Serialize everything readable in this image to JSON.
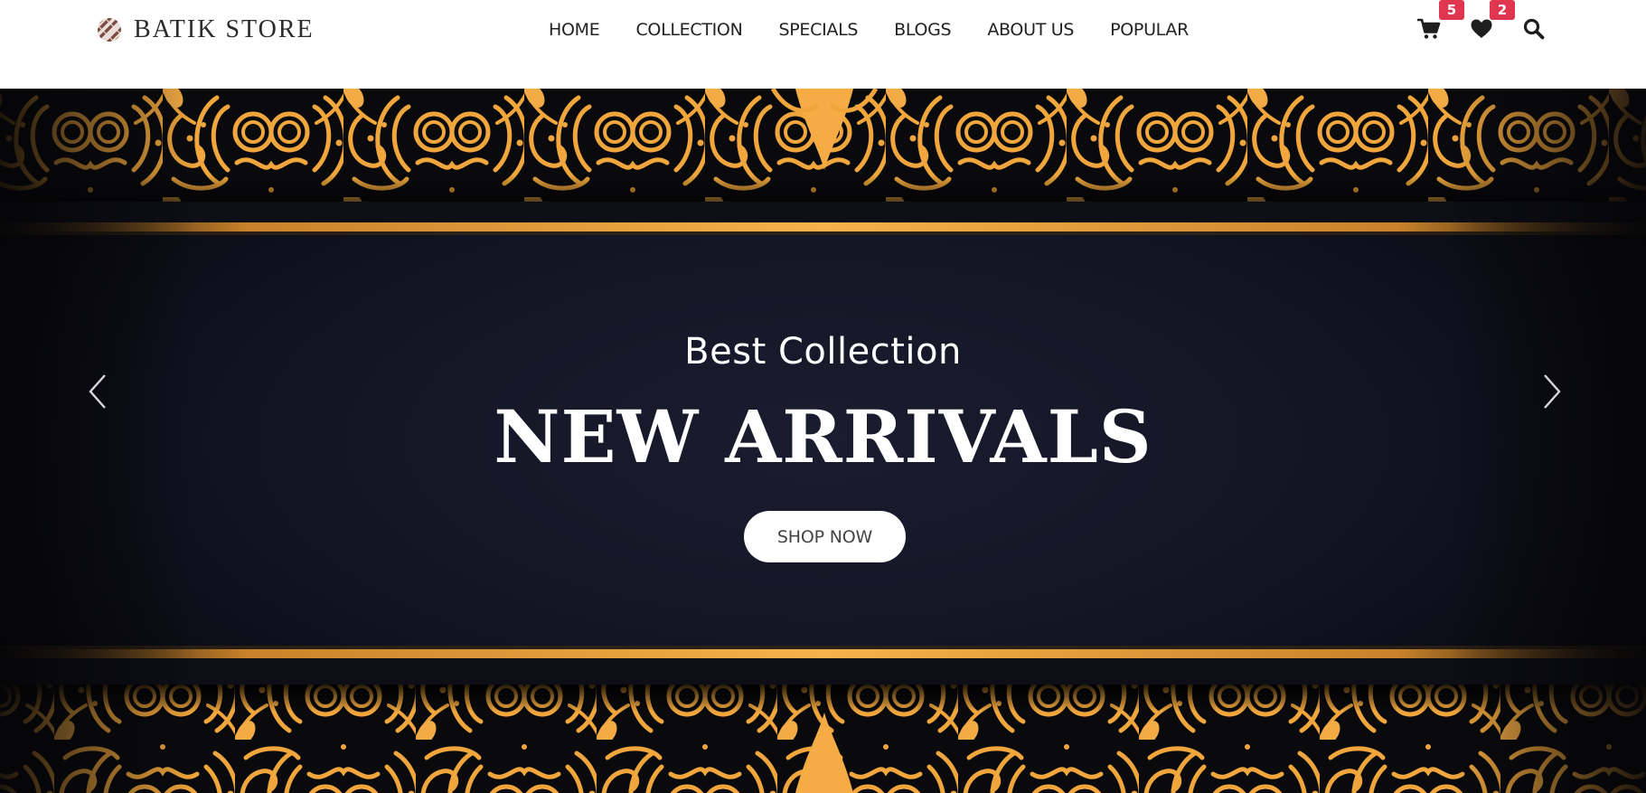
{
  "header": {
    "logo_text": "BATIK STORE",
    "nav": [
      {
        "label": "HOME"
      },
      {
        "label": "COLLECTION"
      },
      {
        "label": "SPECIALS"
      },
      {
        "label": "BLOGS"
      },
      {
        "label": "ABOUT US"
      },
      {
        "label": "POPULAR"
      }
    ],
    "cart_count": "5",
    "wishlist_count": "2",
    "icons": [
      "cart-icon",
      "heart-icon",
      "search-icon"
    ]
  },
  "hero": {
    "subtitle": "Best Collection",
    "title": "NEW ARRIVALS",
    "button_label": "SHOP NOW"
  },
  "colors": {
    "gold": "#f2a93b",
    "badge": "#e0364f",
    "hero_dark": "#16172a"
  }
}
